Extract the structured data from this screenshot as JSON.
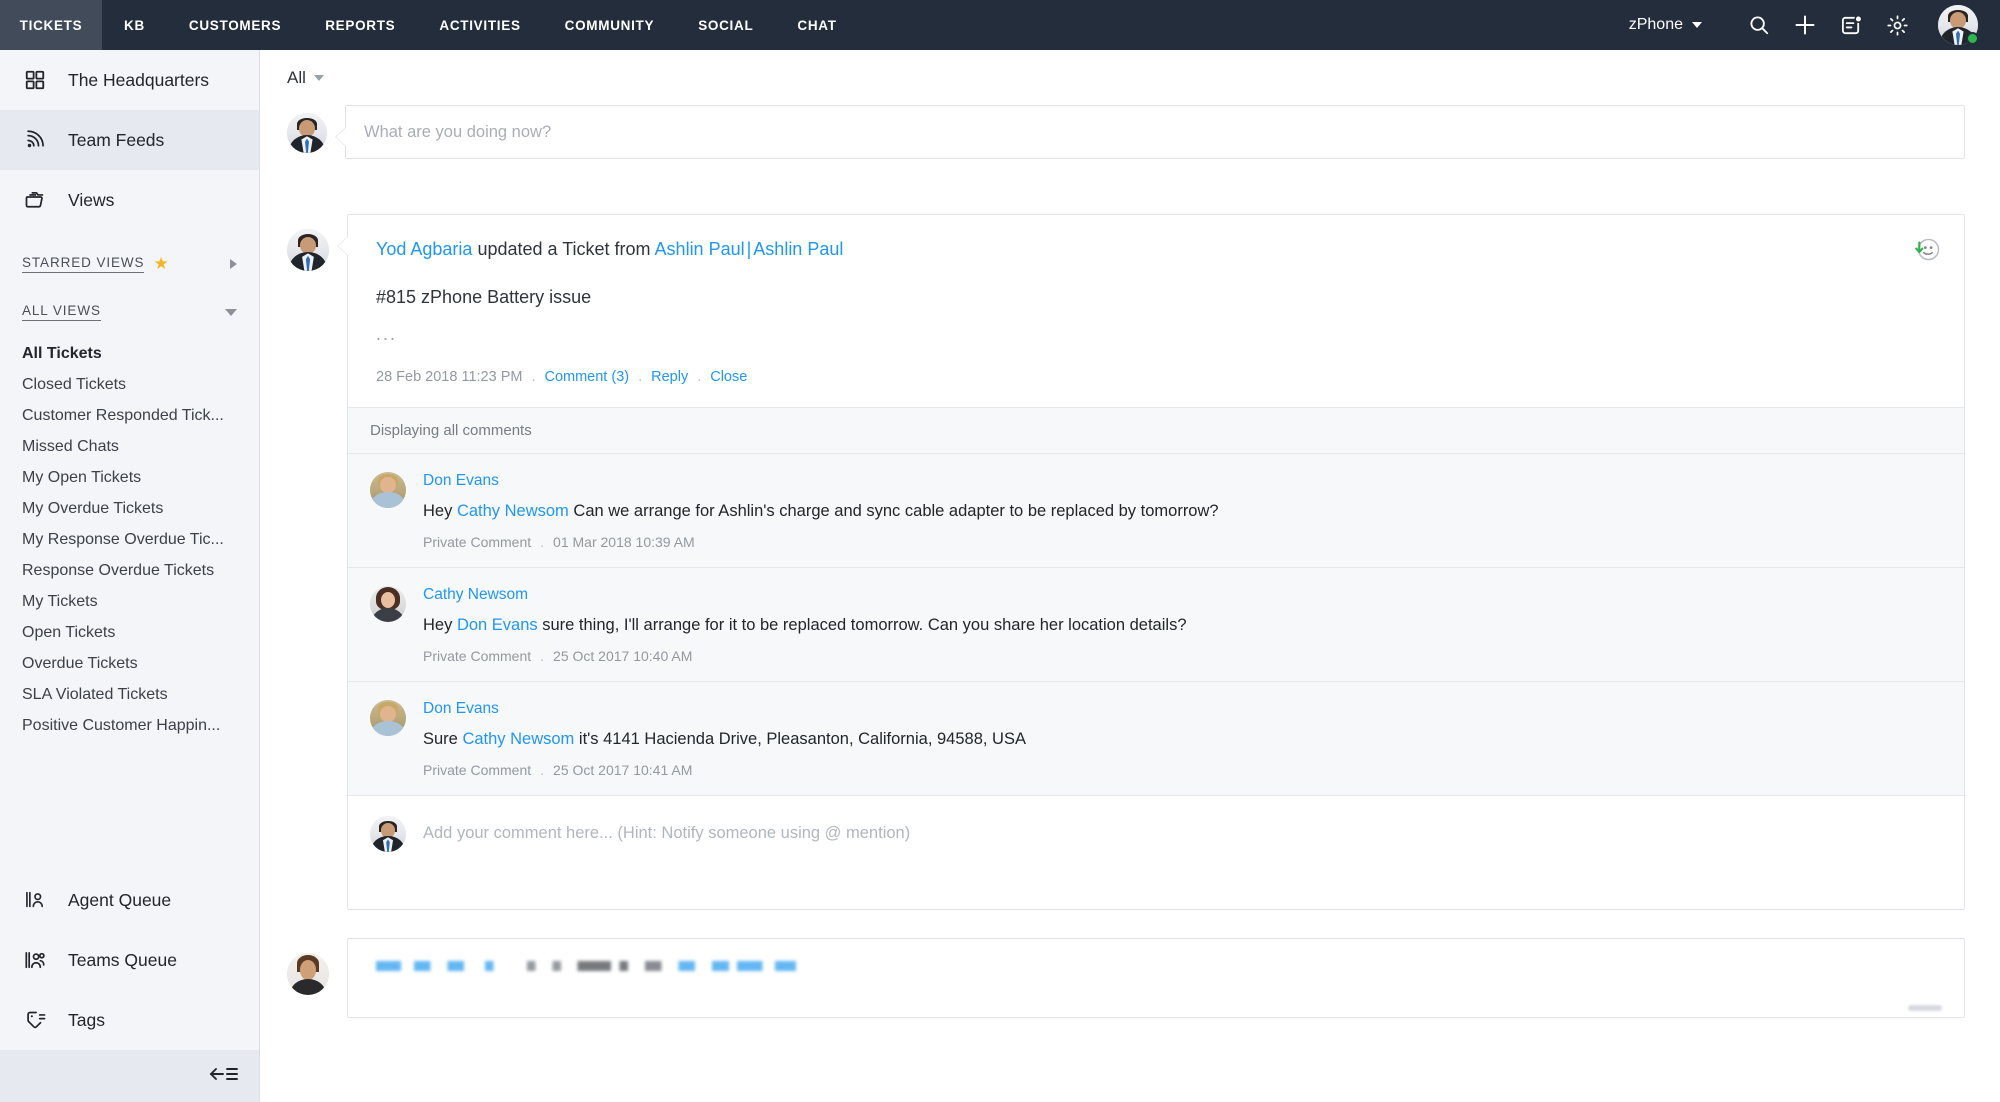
{
  "topnav": {
    "tabs": [
      {
        "label": "TICKETS",
        "active": true
      },
      {
        "label": "KB",
        "active": false
      },
      {
        "label": "CUSTOMERS",
        "active": false
      },
      {
        "label": "REPORTS",
        "active": false
      },
      {
        "label": "ACTIVITIES",
        "active": false
      },
      {
        "label": "COMMUNITY",
        "active": false
      },
      {
        "label": "SOCIAL",
        "active": false
      },
      {
        "label": "CHAT",
        "active": false
      }
    ],
    "brand": "zPhone",
    "icons": [
      "search-icon",
      "add-icon",
      "notes-icon",
      "gear-icon"
    ],
    "user_status": "online",
    "colors": {
      "bar": "#242d3c",
      "active_tab": "#414b5a",
      "status": "#2db84c"
    }
  },
  "sidebar": {
    "main_items": [
      {
        "label": "The Headquarters",
        "icon": "grid-icon",
        "active": false
      },
      {
        "label": "Team Feeds",
        "icon": "feed-icon",
        "active": true
      },
      {
        "label": "Views",
        "icon": "views-folder-icon",
        "active": false
      }
    ],
    "starred_section": {
      "label": "STARRED VIEWS",
      "icon": "star-icon",
      "expander": "chevron-right-icon"
    },
    "all_views_section": {
      "label": "ALL VIEWS",
      "expander": "chevron-down-icon"
    },
    "views": [
      {
        "label": "All Tickets",
        "current": true
      },
      {
        "label": "Closed Tickets",
        "current": false
      },
      {
        "label": "Customer Responded Tick...",
        "current": false
      },
      {
        "label": "Missed Chats",
        "current": false
      },
      {
        "label": "My Open Tickets",
        "current": false
      },
      {
        "label": "My Overdue Tickets",
        "current": false
      },
      {
        "label": "My Response Overdue Tic...",
        "current": false
      },
      {
        "label": "Response Overdue Tickets",
        "current": false
      },
      {
        "label": "My Tickets",
        "current": false
      },
      {
        "label": "Open Tickets",
        "current": false
      },
      {
        "label": "Overdue Tickets",
        "current": false
      },
      {
        "label": "SLA Violated Tickets",
        "current": false
      },
      {
        "label": "Positive Customer Happin...",
        "current": false
      }
    ],
    "bottom_items": [
      {
        "label": "Agent Queue",
        "icon": "agent-queue-icon"
      },
      {
        "label": "Teams Queue",
        "icon": "teams-queue-icon"
      },
      {
        "label": "Tags",
        "icon": "tag-icon"
      }
    ],
    "collapse_icon": "collapse-sidebar-icon",
    "colors": {
      "bg": "#f4f5f8",
      "active": "#e6e9f0"
    }
  },
  "main": {
    "filter": {
      "label": "All",
      "caret": "chevron-down-icon"
    },
    "composer": {
      "placeholder": "What are you doing now?"
    },
    "post": {
      "author": "Yod Agbaria",
      "action": " updated a Ticket from ",
      "from_a": "Ashlin Paul",
      "pipe": "|",
      "from_b": "Ashlin Paul",
      "subject": "#815 zPhone Battery issue",
      "ellipsis": "...",
      "timestamp": "28 Feb 2018 11:23 PM",
      "dot": ".",
      "actions": [
        {
          "label": "Comment (3)"
        },
        {
          "label": "Reply"
        },
        {
          "label": "Close"
        }
      ],
      "happiness_icon": "happy-face-icon"
    },
    "comments_header": "Displaying all comments",
    "comments": [
      {
        "author": "Don Evans",
        "avatar": "av-don",
        "text_pre": "Hey ",
        "mention": "Cathy Newsom",
        "text_post": " Can we arrange for Ashlin's charge and sync cable adapter to be replaced by tomorrow?",
        "visibility": "Private Comment",
        "dot": ".",
        "timestamp": "01 Mar 2018 10:39 AM"
      },
      {
        "author": "Cathy Newsom",
        "avatar": "av-cathy",
        "text_pre": "Hey ",
        "mention": "Don Evans",
        "text_post": " sure thing, I'll arrange for it to be replaced tomorrow. Can you share her location details?",
        "visibility": "Private Comment",
        "dot": ".",
        "timestamp": "25 Oct 2017 10:40 AM"
      },
      {
        "author": "Don Evans",
        "avatar": "av-don",
        "text_pre": "Sure ",
        "mention": "Cathy Newsom",
        "text_post": " it's 4141 Hacienda Drive, Pleasanton, California, 94588, USA",
        "visibility": "Private Comment",
        "dot": ".",
        "timestamp": "25 Oct 2017 10:41 AM"
      }
    ],
    "comment_input": {
      "placeholder": "Add your comment here... (Hint: Notify someone using @ mention)"
    },
    "colors": {
      "link": "#2196f3",
      "comment_bg": "#f7f8f9",
      "border": "#e0e3e8"
    }
  }
}
